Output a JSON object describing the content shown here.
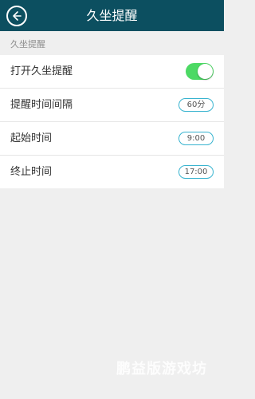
{
  "header": {
    "title": "久坐提醒",
    "back_icon": "arrow-left-icon"
  },
  "section": {
    "label": "久坐提醒"
  },
  "settings": [
    {
      "label": "打开久坐提醒",
      "control": "toggle",
      "enabled": true
    },
    {
      "label": "提醒时间间隔",
      "value": "60分"
    },
    {
      "label": "起始时间",
      "value": "9:00"
    },
    {
      "label": "终止时间",
      "value": "17:00"
    }
  ],
  "watermark": "鹏益版游戏坊",
  "colors": {
    "app_bar": "#0c4f60",
    "toggle_on": "#4cd964",
    "pill_border": "#37b3cf",
    "background": "#efefef"
  }
}
